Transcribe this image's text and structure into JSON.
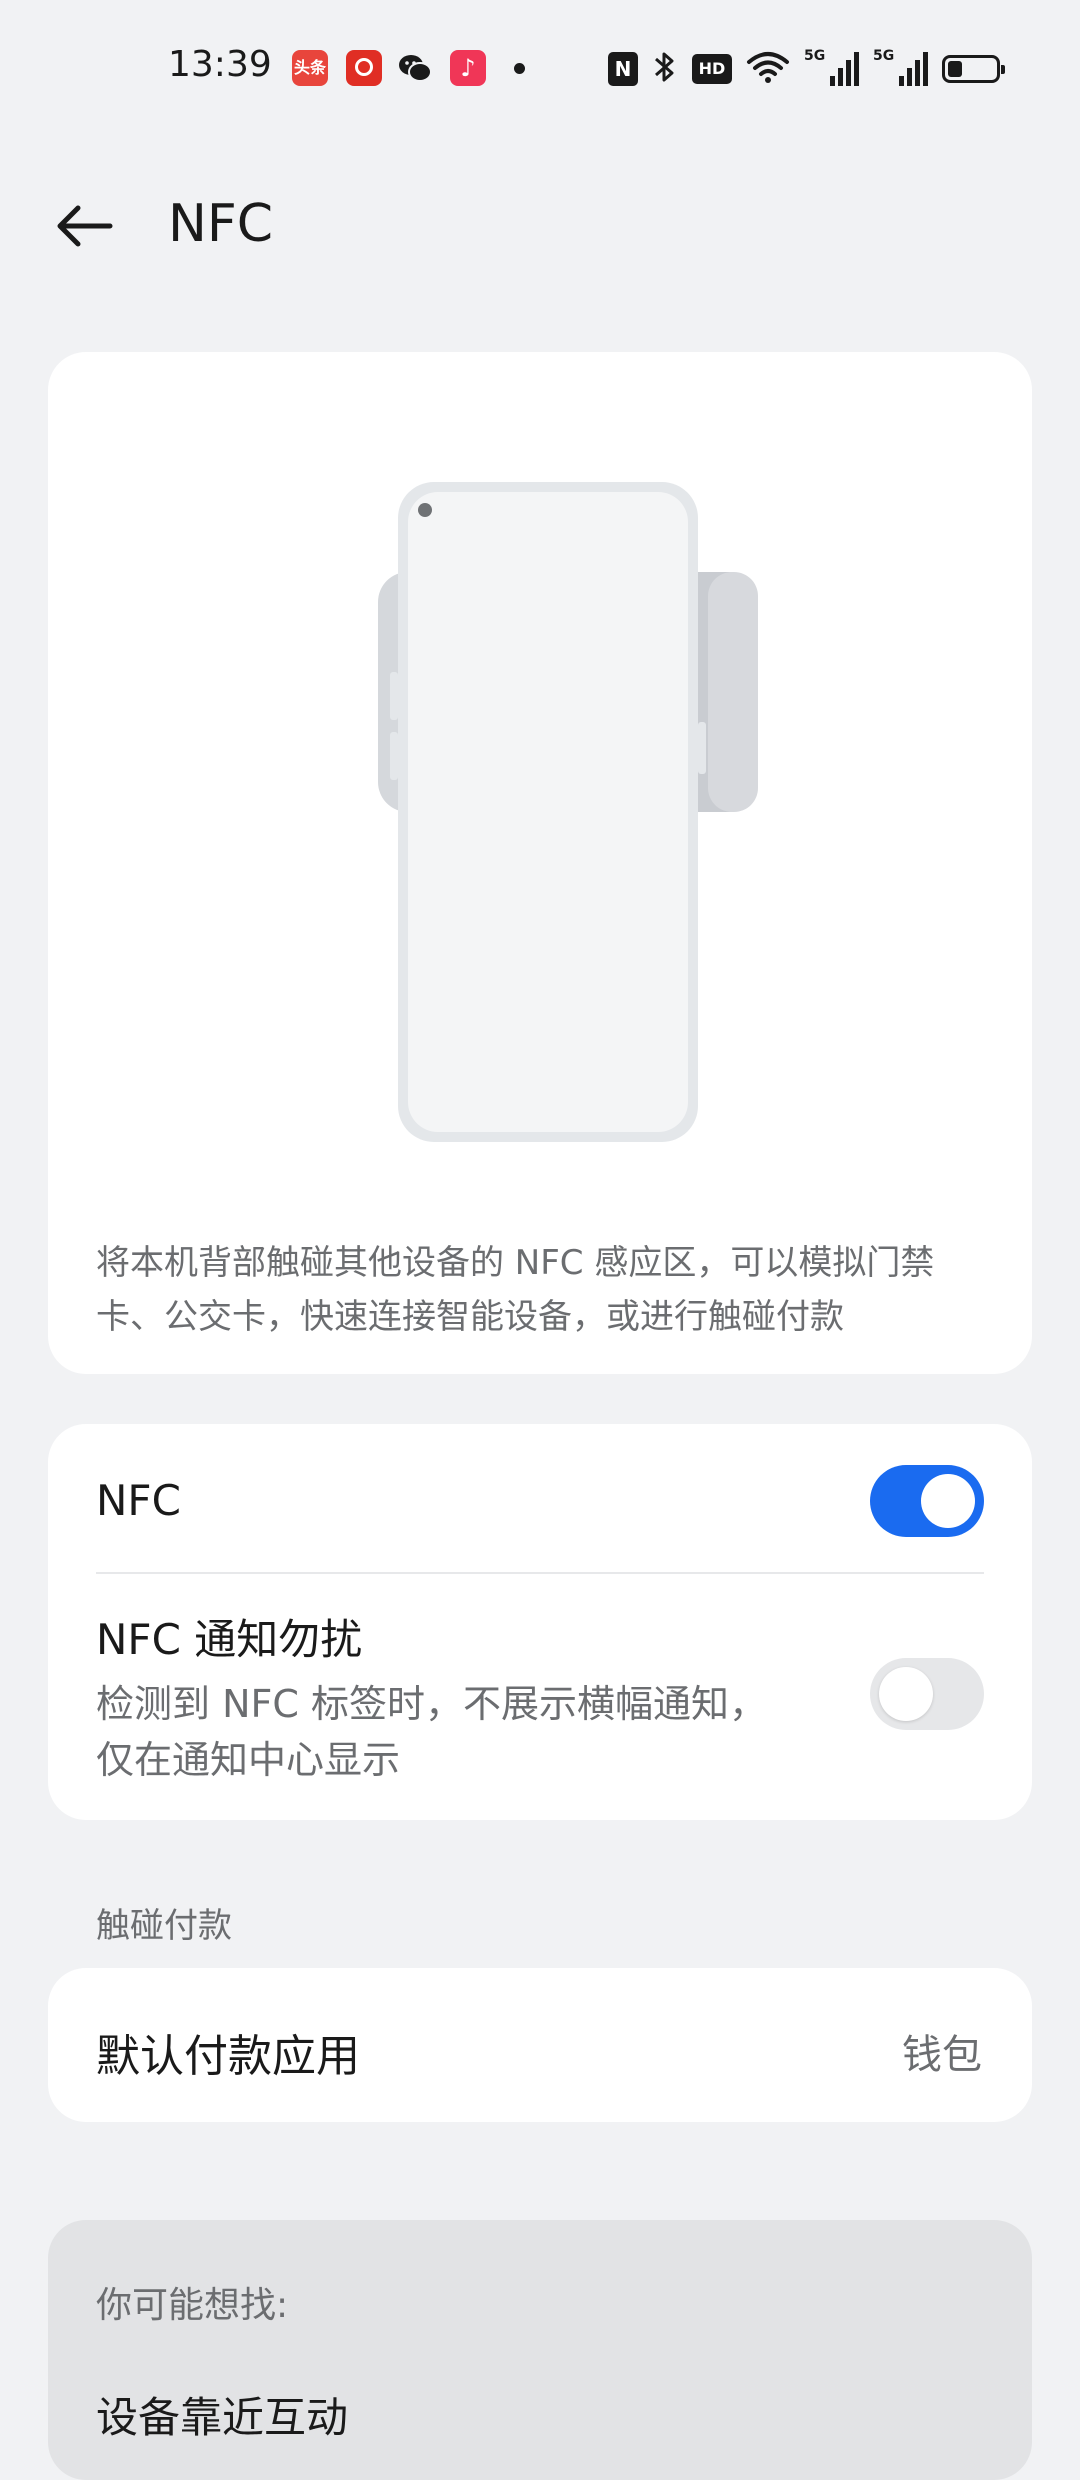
{
  "status_bar": {
    "time": "13:39",
    "toutiao_label": "头条",
    "signal1_label": "5G",
    "signal2_label": "5G",
    "nfc_badge": "N",
    "hd_badge": "HD"
  },
  "header": {
    "title": "NFC"
  },
  "hero": {
    "description": "将本机背部触碰其他设备的 NFC 感应区，可以模拟门禁卡、公交卡，快速连接智能设备，或进行触碰付款"
  },
  "settings": {
    "nfc": {
      "label": "NFC",
      "enabled": true
    },
    "nfc_dnd": {
      "title": "NFC 通知勿扰",
      "description": "检测到 NFC 标签时，不展示横幅通知，仅在通知中心显示",
      "enabled": false
    }
  },
  "payment_section": {
    "header": "触碰付款",
    "default_app_label": "默认付款应用",
    "default_app_value": "钱包"
  },
  "suggestions": {
    "title": "你可能想找:",
    "items": [
      "设备靠近互动"
    ]
  },
  "colors": {
    "accent": "#1a6bf0",
    "background": "#f1f2f4",
    "card": "#ffffff"
  }
}
